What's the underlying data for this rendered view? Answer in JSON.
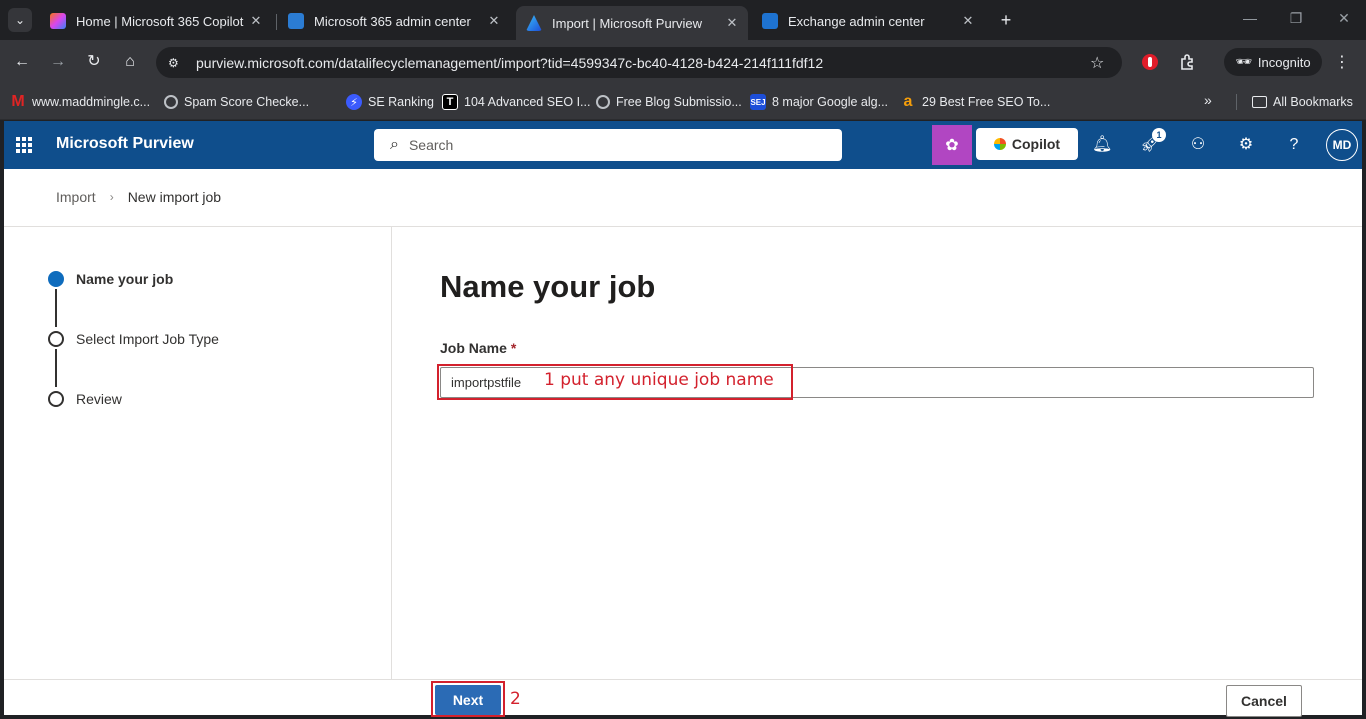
{
  "browser": {
    "tabs": [
      {
        "title": "Home | Microsoft 365 Copilot",
        "close": "✕",
        "favicon_color": "#d946ef"
      },
      {
        "title": "Microsoft 365 admin center",
        "close": "✕",
        "favicon_color": "#2b7cd3"
      },
      {
        "title": "Import | Microsoft Purview",
        "close": "✕",
        "favicon_color": "#3b8eea"
      },
      {
        "title": "Exchange admin center",
        "close": "✕",
        "favicon_color": "#1e73d1"
      }
    ],
    "new_tab": "+",
    "url": "purview.microsoft.com/datalifecyclemanagement/import?tid=4599347c-bc40-4128-b424-214f111fdf12",
    "incognito_label": "Incognito",
    "bookmarks": [
      {
        "label": "www.maddmingle.c...",
        "icon": "M",
        "color": "#e02424"
      },
      {
        "label": "Spam Score Checke...",
        "icon": "",
        "color": "#9aa0a6"
      },
      {
        "label": "SE Ranking",
        "icon": "⚡",
        "color": "#3b5bfd"
      },
      {
        "label": "104 Advanced SEO I...",
        "icon": "T",
        "color": "#000000"
      },
      {
        "label": "Free Blog Submissio...",
        "icon": "",
        "color": "#9aa0a6"
      },
      {
        "label": "8 major Google alg...",
        "icon": "SEJ",
        "color": "#1d4ed8"
      },
      {
        "label": "29 Best Free SEO To...",
        "icon": "a",
        "color": "#f59e0b"
      }
    ],
    "bookmarks_more": "»",
    "all_bookmarks": "All Bookmarks"
  },
  "header": {
    "app_title": "Microsoft Purview",
    "search_placeholder": "Search",
    "copilot_label": "Copilot",
    "notification_count": "1",
    "avatar_initials": "MD"
  },
  "breadcrumb": {
    "root": "Import",
    "sep": "›",
    "current": "New import job"
  },
  "steps": [
    {
      "label": "Name your job",
      "active": true
    },
    {
      "label": "Select Import Job Type",
      "active": false
    },
    {
      "label": "Review",
      "active": false
    }
  ],
  "main": {
    "heading": "Name your job",
    "field_label": "Job Name",
    "required_mark": "*",
    "job_name_value": "importpstfile"
  },
  "annotations": {
    "note1": "1 put any unique job name",
    "note2": "2"
  },
  "footer": {
    "next_label": "Next",
    "cancel_label": "Cancel"
  },
  "colors": {
    "header_bg": "#0f4e8c",
    "primary_button": "#2b6bb5",
    "annotation_red": "#d3212d",
    "copilot_accent": "#b146c2"
  }
}
